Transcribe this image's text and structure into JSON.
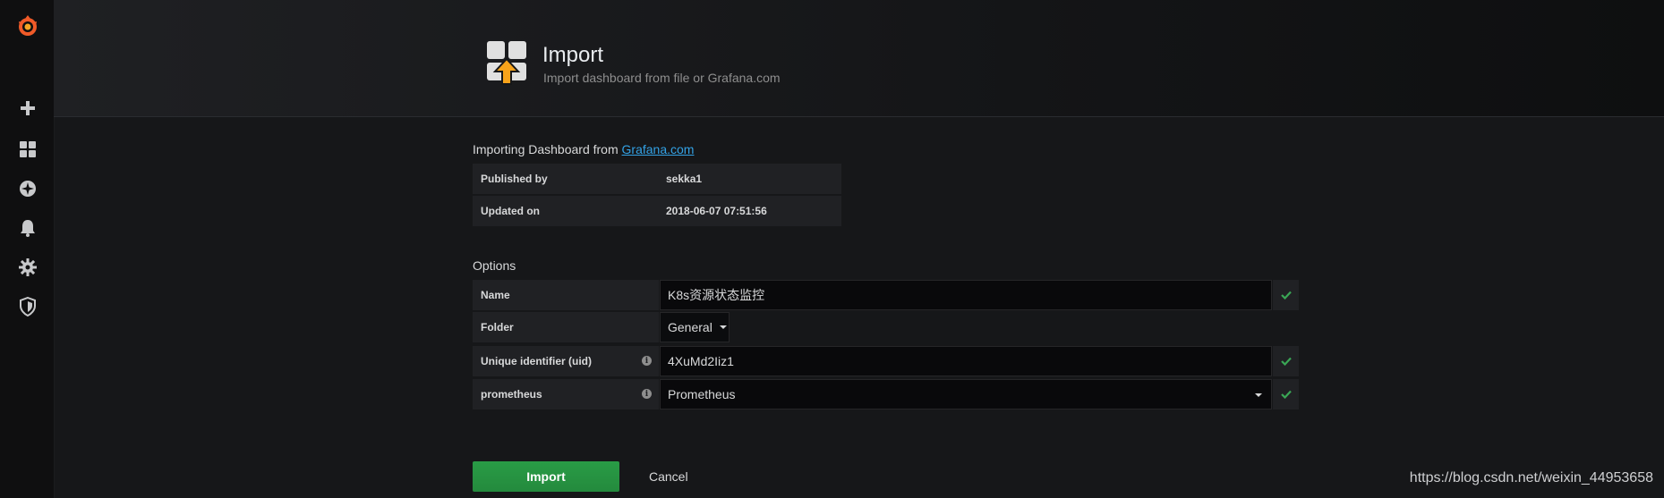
{
  "header": {
    "title": "Import",
    "subtitle": "Import dashboard from file or Grafana.com"
  },
  "sidebar": {
    "items": [
      {
        "name": "grafana-logo-icon"
      },
      {
        "name": "plus-icon"
      },
      {
        "name": "dashboards-icon"
      },
      {
        "name": "explore-compass-icon"
      },
      {
        "name": "alerting-bell-icon"
      },
      {
        "name": "configuration-gear-icon"
      },
      {
        "name": "server-admin-shield-icon"
      }
    ]
  },
  "importing": {
    "prefix": "Importing Dashboard from ",
    "link": "Grafana.com",
    "rows": [
      {
        "key": "Published by",
        "value": "sekka1"
      },
      {
        "key": "Updated on",
        "value": "2018-06-07 07:51:56"
      }
    ]
  },
  "options": {
    "heading": "Options",
    "name_label": "Name",
    "name_value": "K8s资源状态监控",
    "folder_label": "Folder",
    "folder_value": "General",
    "uid_label": "Unique identifier (uid)",
    "uid_value": "4XuMd2Iiz1",
    "prometheus_label": "prometheus",
    "prometheus_value": "Prometheus"
  },
  "buttons": {
    "import": "Import",
    "cancel": "Cancel"
  },
  "watermark": "https://blog.csdn.net/weixin_44953658",
  "colors": {
    "accent_green": "#299c46",
    "link": "#33a2e5",
    "logo_orange": "#f05a28"
  }
}
